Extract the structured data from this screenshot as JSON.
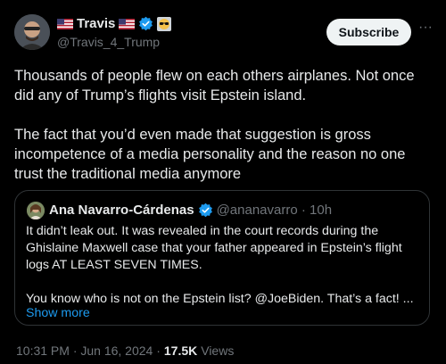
{
  "author": {
    "display_name": "Travis",
    "handle": "@Travis_4_Trump",
    "verified_color": "#1d9bf0"
  },
  "actions": {
    "subscribe_label": "Subscribe",
    "more_icon": "···"
  },
  "tweet": {
    "text": "Thousands of people flew on each others airplanes. Not once did any of Trump’s flights visit Epstein island.\n\nThe fact that you’d even made that suggestion is gross incompetence of a media personality and the reason no one trust the traditional media anymore"
  },
  "quoted": {
    "display_name": "Ana Navarro-Cárdenas",
    "handle_time": "@ananavarro · 10h",
    "text": "It didn’t leak out. It was revealed in the court records during the Ghislaine Maxwell case that your father appeared in Epstein’s flight logs AT LEAST SEVEN TIMES.\n\nYou know who is not on the Epstein list? @JoeBiden. That’s a fact! ...",
    "show_more": "Show more"
  },
  "meta": {
    "timestamp": "10:31 PM · Jun 16, 2024 ·",
    "views_count": "17.5K",
    "views_label": "Views"
  }
}
